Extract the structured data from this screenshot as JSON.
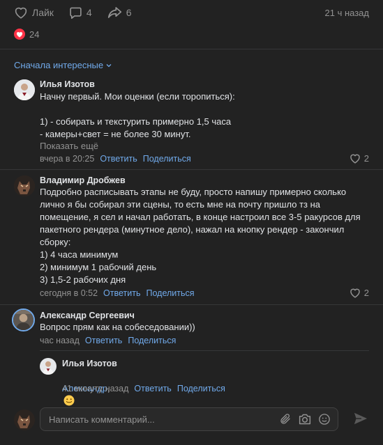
{
  "post_actions": {
    "like_label": "Лайк",
    "comments_count": "4",
    "shares_count": "6",
    "time": "21 ч назад"
  },
  "reactions": {
    "count": "24"
  },
  "sort": {
    "label": "Сначала интересные"
  },
  "comments": [
    {
      "author": "Илья Изотов",
      "text": "Начну первый. Мои оценки (если торопиться):\n\n1) - собирать и текстурить примерно 1,5 часа\n- камеры+свет = не более 30 минут.",
      "show_more": "Показать ещё",
      "time": "вчера в 20:25",
      "reply": "Ответить",
      "share": "Поделиться",
      "likes": "2"
    },
    {
      "author": "Владимир Дробжев",
      "text": "Подробно расписывать этапы не буду, просто напишу примерно сколько лично я бы собирал эти сцены, то есть мне на почту пришло тз на помещение, я сел и начал работать, в конце настроил все 3-5 ракурсов для пакетного рендера (минутное дело), нажал на кнопку рендер - закончил сборку:\n1) 4 часа минимум\n2) минимум 1 рабочий день\n3) 1,5-2 рабочих дня",
      "time": "сегодня в 0:52",
      "reply": "Ответить",
      "share": "Поделиться",
      "likes": "2"
    },
    {
      "author": "Александр Сергеевич",
      "text": "Вопрос прям как на собеседовании))",
      "time": "час назад",
      "reply": "Ответить",
      "share": "Поделиться"
    }
  ],
  "reply": {
    "author": "Илья Изотов",
    "mention": "Александр",
    "after_mention": ",",
    "time": "41 минуту назад",
    "reply": "Ответить",
    "share": "Поделиться"
  },
  "composer": {
    "placeholder": "Написать комментарий..."
  },
  "colors": {
    "background": "#222222",
    "link": "#71aaeb",
    "muted": "#939393",
    "like_red": "#ff3347"
  }
}
